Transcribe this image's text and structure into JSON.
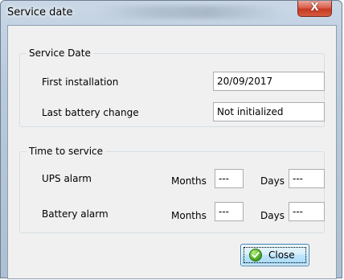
{
  "window": {
    "title": "Service date",
    "close_glyph": "X"
  },
  "service_date": {
    "group_label": "Service Date",
    "first_installation": {
      "label": "First installation",
      "value": "20/09/2017"
    },
    "last_battery_change": {
      "label": "Last battery change",
      "value": "Not initialized"
    }
  },
  "time_to_service": {
    "group_label": "Time to service",
    "ups_alarm": {
      "label": "UPS alarm",
      "months_label": "Months",
      "months_value": "---",
      "days_label": "Days",
      "days_value": "---"
    },
    "battery_alarm": {
      "label": "Battery alarm",
      "months_label": "Months",
      "months_value": "---",
      "days_label": "Days",
      "days_value": "---"
    }
  },
  "buttons": {
    "close_label": "Close",
    "close_icon": "check-icon"
  },
  "colors": {
    "close_button_border": "#3c7fb1",
    "title_close_red": "#c63a22",
    "client_background": "#f0f0f0"
  }
}
